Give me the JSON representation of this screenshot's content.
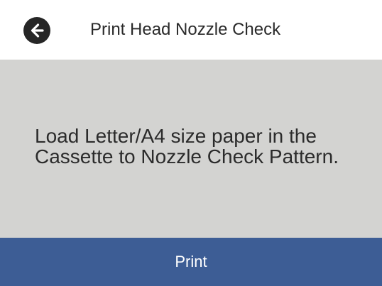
{
  "header": {
    "back_icon": "back-arrow-icon",
    "title": "Print Head Nozzle Check"
  },
  "message": {
    "line1": "Load Letter/A4 size paper in the",
    "line2": "Cassette to Nozzle Check Pattern."
  },
  "footer": {
    "print_label": "Print"
  },
  "colors": {
    "header_bg": "#ffffff",
    "message_bg": "#d3d3d1",
    "print_bar_bg": "#3d5d95",
    "back_button_bg": "#262626",
    "text": "#2a2a2a"
  }
}
